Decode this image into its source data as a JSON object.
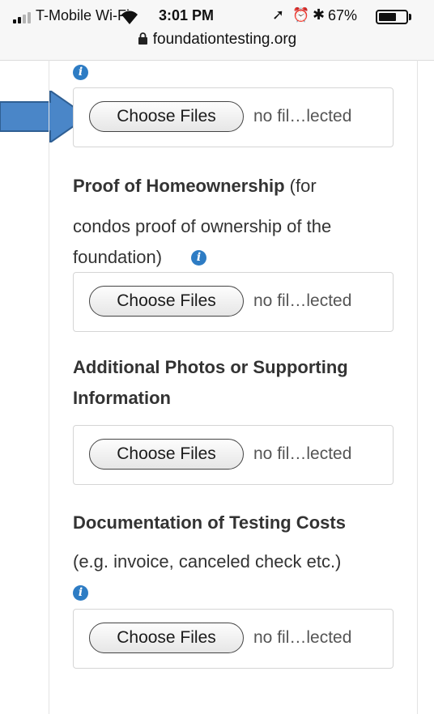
{
  "status_bar": {
    "carrier": "T-Mobile Wi-Fi",
    "time": "3:01 PM",
    "battery_percent": "67%",
    "battery_level": 0.67,
    "signal_bars_active": 2,
    "icons": [
      "signal-icon",
      "wifi-icon",
      "location-arrow-icon",
      "alarm-icon",
      "bluetooth-icon",
      "battery-icon"
    ]
  },
  "address_bar": {
    "url": "foundationtesting.org",
    "icon": "lock-icon"
  },
  "uploads": [
    {
      "label_bold": "",
      "label_rest": "",
      "button_label": "Choose Files",
      "status_text": "no fil…lected"
    },
    {
      "label_bold": "Proof of Homeownership",
      "label_rest": " (for",
      "label_line2": "condos proof of ownership of the",
      "label_line3": "foundation)",
      "button_label": "Choose Files",
      "status_text": "no fil…lected"
    },
    {
      "label_bold_line1": "Additional Photos or Supporting",
      "label_bold_line2": "Information",
      "button_label": "Choose Files",
      "status_text": "no fil…lected"
    },
    {
      "label_bold": "Documentation of Testing Costs",
      "label_line2": "(e.g. invoice, canceled check etc.)",
      "button_label": "Choose Files",
      "status_text": "no fil…lected"
    }
  ],
  "colors": {
    "info_icon": "#2d7cc4",
    "annotation_arrow": "#4a86c8",
    "annotation_arrow_stroke": "#2f5f93"
  },
  "annotation": {
    "icon": "blue-arrow-icon"
  }
}
